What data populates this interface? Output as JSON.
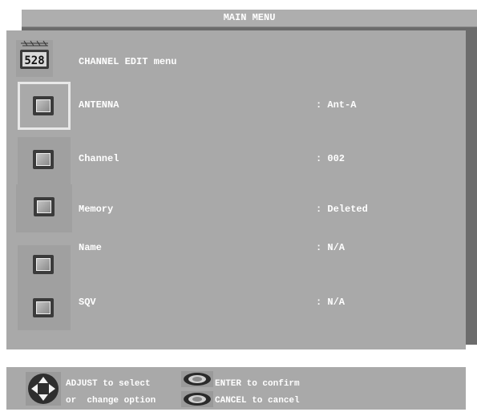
{
  "window": {
    "title": "MAIN MENU"
  },
  "header": {
    "icon": "channel-528-icon",
    "icon_text": "528",
    "label": "CHANNEL EDIT menu"
  },
  "rows": [
    {
      "label": "ANTENNA",
      "value": ": Ant-A",
      "selected": true,
      "icon": "tv-button-icon"
    },
    {
      "label": "Channel",
      "value": ": 002",
      "selected": false,
      "icon": "tv-button-icon"
    },
    {
      "label": "Memory",
      "value": ": Deleted",
      "selected": false,
      "icon": "tv-button-icon"
    },
    {
      "label": "Name",
      "value": ": N/A",
      "selected": false,
      "icon": "tv-button-icon"
    },
    {
      "label": "SQV",
      "value": ": N/A",
      "selected": false,
      "icon": "tv-button-icon"
    }
  ],
  "footer": {
    "adjust_line1": "ADJUST to select",
    "adjust_line2": "or  change option",
    "enter_text": "ENTER to confirm",
    "cancel_text": "CANCEL to cancel",
    "dpad_icon": "dpad-icon",
    "enter_icon": "enter-eye-icon",
    "cancel_icon": "cancel-eye-icon"
  },
  "colors": {
    "panel": "#a9a9a9",
    "shadow": "#6c6c6c",
    "text": "#ffffff"
  }
}
